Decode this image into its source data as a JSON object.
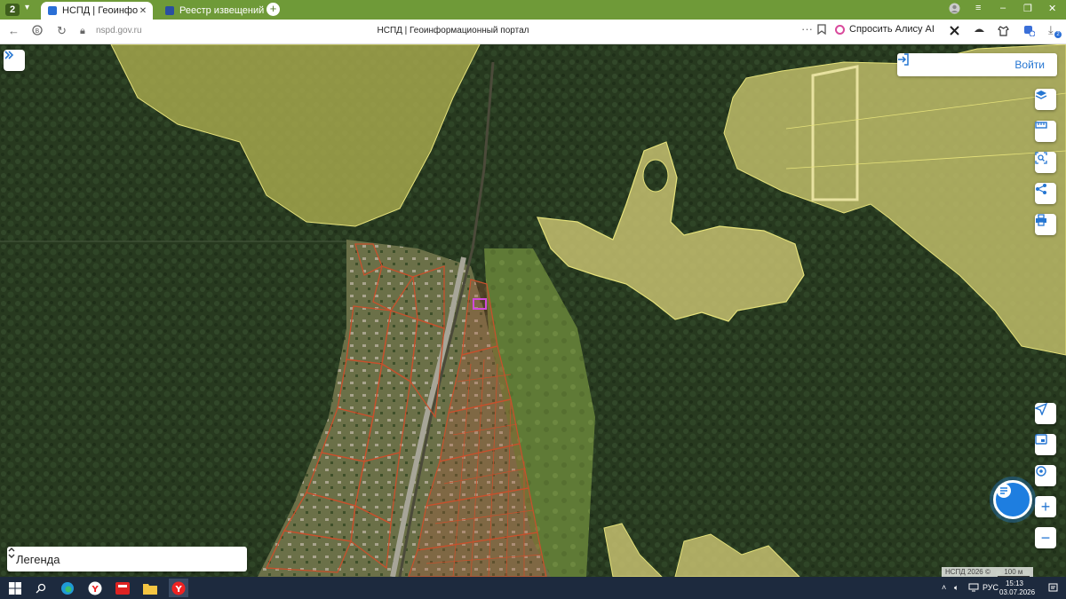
{
  "browser": {
    "tab_count": "2",
    "tabs": [
      {
        "label": "НСПД | Геоинформаци",
        "active": true,
        "favicon_color": "#2a6fd6"
      },
      {
        "label": "Реестр извещений",
        "active": false,
        "favicon_color": "#2a4fa0"
      }
    ],
    "url": "nspd.gov.ru",
    "page_title": "НСПД | Геоинформационный портал",
    "alice_label": "Спросить Алису AI",
    "extension_badge": "2",
    "accent_color": "#6f9a38"
  },
  "map": {
    "login_label": "Войти",
    "legend_label": "Легенда",
    "attribution": "НСПД 2026 ©",
    "scale_label": "100 м",
    "tools": [
      "layers-icon",
      "ruler-icon",
      "zoom-area-icon",
      "share-icon",
      "print-icon"
    ],
    "nav_tools": [
      "locate-icon",
      "minimap-icon",
      "geolocation-icon"
    ],
    "zoom_in_label": "+",
    "zoom_out_label": "−",
    "parcel_color": "#c8502c",
    "zone_color": "#e6e27a",
    "highlight_color": "#d04ad8"
  },
  "taskbar": {
    "language": "РУС",
    "time": "15:13",
    "date": "03.07.2026"
  }
}
